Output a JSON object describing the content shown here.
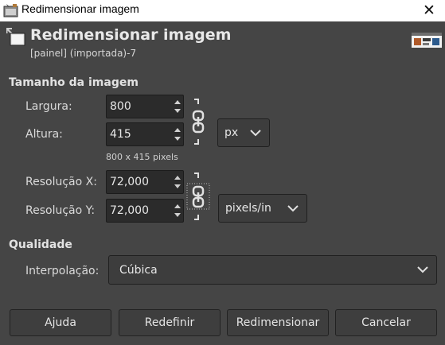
{
  "window": {
    "title": "Redimensionar imagem",
    "close_icon": "close-icon"
  },
  "header": {
    "title": "Redimensionar imagem",
    "subtitle": "[painel] (importada)-7",
    "icon": "scale-image-icon",
    "thumbnail": "image-thumbnail"
  },
  "image_size": {
    "section_title": "Tamanho da imagem",
    "width_label": "Largura:",
    "width_value": "800",
    "height_label": "Altura:",
    "height_value": "415",
    "size_info": "800 x 415 pixels",
    "unit": "px",
    "res_x_label": "Resolução X:",
    "res_x_value": "72,000",
    "res_y_label": "Resolução Y:",
    "res_y_value": "72,000",
    "res_unit": "pixels/in"
  },
  "quality": {
    "section_title": "Qualidade",
    "interpolation_label": "Interpolação:",
    "interpolation_value": "Cúbica"
  },
  "buttons": {
    "help": "Ajuda",
    "reset": "Redefinir",
    "resize": "Redimensionar",
    "cancel": "Cancelar"
  },
  "colors": {
    "background": "#454545",
    "field": "#2b2b2b",
    "titlebar": "#ffffff"
  }
}
